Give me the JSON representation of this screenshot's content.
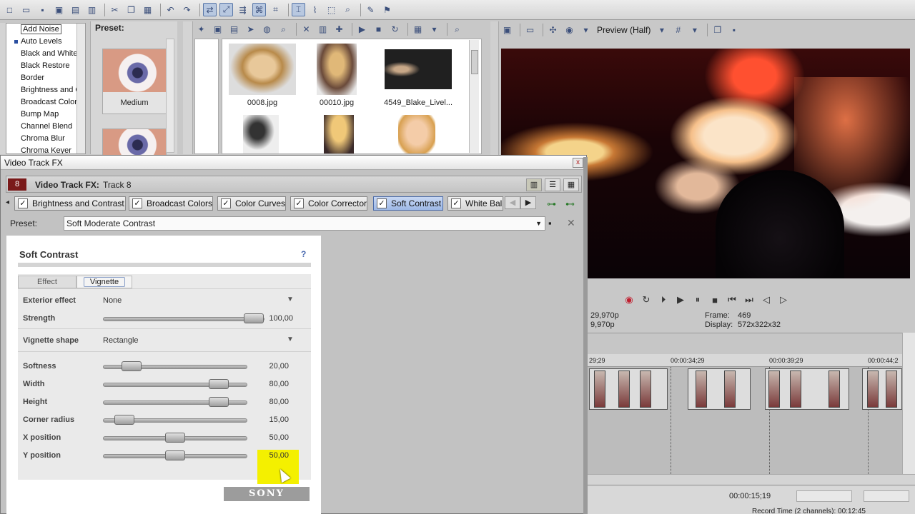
{
  "fx_list": {
    "items": [
      "Add Noise",
      "Auto Levels",
      "Black and White",
      "Black Restore",
      "Border",
      "Brightness and Contrast",
      "Broadcast Colors",
      "Bump Map",
      "Channel Blend",
      "Chroma Blur",
      "Chroma Keyer"
    ],
    "selected": "Add Noise"
  },
  "preset_pane": {
    "title": "Preset:",
    "items": [
      "Medium"
    ]
  },
  "media": {
    "row1": [
      "0008.jpg",
      "00010.jpg",
      "4549_Blake_Livel..."
    ]
  },
  "preview": {
    "mode": "Preview (Half)",
    "project_res": "29,970p",
    "preview_res": "9,970p",
    "frame_label": "Frame:",
    "frame_value": "469",
    "display_label": "Display:",
    "display_value": "572x322x32"
  },
  "timeline": {
    "marks": [
      "29;29",
      "00:00:34;29",
      "00:00:39;29",
      "00:00:44;2"
    ],
    "timecode": "00:00:15;19",
    "record_time": "Record Time (2 channels): 00:12:45"
  },
  "dialog": {
    "title": "Video Track FX",
    "close": "x",
    "track_no": "8",
    "fx_label": "Video Track FX:",
    "track_name": "Track 8",
    "chain": [
      {
        "label": "Brightness and Contrast",
        "active": false
      },
      {
        "label": "Broadcast Colors",
        "active": false
      },
      {
        "label": "Color Curves",
        "active": false
      },
      {
        "label": "Color Corrector",
        "active": false
      },
      {
        "label": "Soft Contrast",
        "active": true
      },
      {
        "label": "White Bal",
        "active": false
      }
    ],
    "preset_label": "Preset:",
    "preset_value": "Soft Moderate Contrast"
  },
  "panel": {
    "title": "Soft Contrast",
    "help": "?",
    "tabs": [
      "Effect",
      "Vignette"
    ],
    "active_tab": "Vignette",
    "exterior_effect_label": "Exterior effect",
    "exterior_effect_value": "None",
    "strength_label": "Strength",
    "strength_value": "100,00",
    "vignette_shape_label": "Vignette shape",
    "vignette_shape_value": "Rectangle",
    "sliders": [
      {
        "label": "Softness",
        "value": "20,00",
        "fraction": 0.2
      },
      {
        "label": "Width",
        "value": "80,00",
        "fraction": 0.8
      },
      {
        "label": "Height",
        "value": "80,00",
        "fraction": 0.8
      },
      {
        "label": "Corner radius",
        "value": "15,00",
        "fraction": 0.15
      },
      {
        "label": "X position",
        "value": "50,00",
        "fraction": 0.5
      },
      {
        "label": "Y position",
        "value": "50,00",
        "fraction": 0.5
      }
    ],
    "brand": "SONY"
  }
}
